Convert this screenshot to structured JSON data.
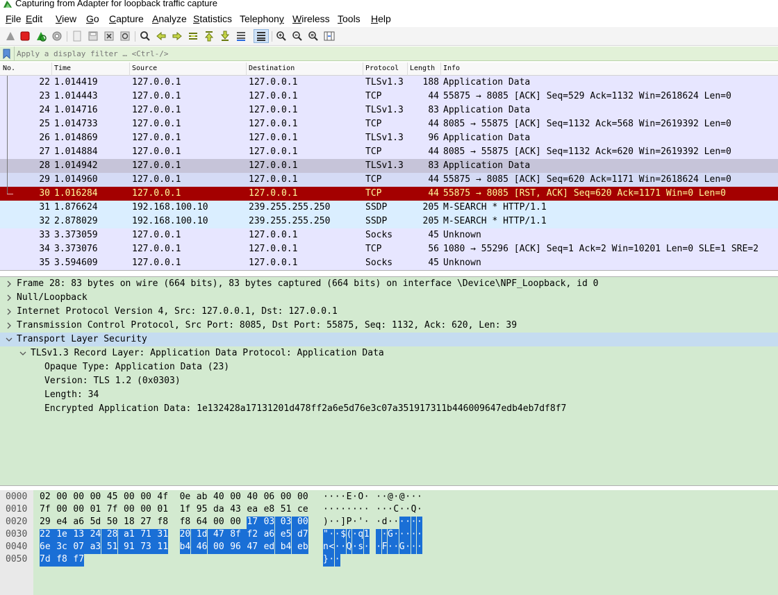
{
  "window": {
    "title": "Capturing from Adapter for loopback traffic capture"
  },
  "menu": [
    {
      "pre": "",
      "u": "F",
      "post": "ile"
    },
    {
      "pre": "",
      "u": "E",
      "post": "dit"
    },
    {
      "pre": "",
      "u": "V",
      "post": "iew"
    },
    {
      "pre": "",
      "u": "G",
      "post": "o"
    },
    {
      "pre": "",
      "u": "C",
      "post": "apture"
    },
    {
      "pre": "",
      "u": "A",
      "post": "nalyze"
    },
    {
      "pre": "",
      "u": "S",
      "post": "tatistics"
    },
    {
      "pre": "Telephon",
      "u": "y",
      "post": ""
    },
    {
      "pre": "",
      "u": "W",
      "post": "ireless"
    },
    {
      "pre": "",
      "u": "T",
      "post": "ools"
    },
    {
      "pre": "",
      "u": "H",
      "post": "elp"
    }
  ],
  "filter": {
    "placeholder": "Apply a display filter … <Ctrl-/>"
  },
  "columns": [
    "No.",
    "Time",
    "Source",
    "Destination",
    "Protocol",
    "Length",
    "Info"
  ],
  "packets": [
    {
      "no": "22",
      "time": "1.014419",
      "src": "127.0.0.1",
      "dst": "127.0.0.1",
      "proto": "TLSv1.3",
      "len": "188",
      "info": "Application Data",
      "style": "tls"
    },
    {
      "no": "23",
      "time": "1.014443",
      "src": "127.0.0.1",
      "dst": "127.0.0.1",
      "proto": "TCP",
      "len": "44",
      "info": "55875 → 8085 [ACK] Seq=529 Ack=1132 Win=2618624 Len=0",
      "style": "tls"
    },
    {
      "no": "24",
      "time": "1.014716",
      "src": "127.0.0.1",
      "dst": "127.0.0.1",
      "proto": "TLSv1.3",
      "len": "83",
      "info": "Application Data",
      "style": "tls"
    },
    {
      "no": "25",
      "time": "1.014733",
      "src": "127.0.0.1",
      "dst": "127.0.0.1",
      "proto": "TCP",
      "len": "44",
      "info": "8085 → 55875 [ACK] Seq=1132 Ack=568 Win=2619392 Len=0",
      "style": "tls"
    },
    {
      "no": "26",
      "time": "1.014869",
      "src": "127.0.0.1",
      "dst": "127.0.0.1",
      "proto": "TLSv1.3",
      "len": "96",
      "info": "Application Data",
      "style": "tls"
    },
    {
      "no": "27",
      "time": "1.014884",
      "src": "127.0.0.1",
      "dst": "127.0.0.1",
      "proto": "TCP",
      "len": "44",
      "info": "8085 → 55875 [ACK] Seq=1132 Ack=620 Win=2619392 Len=0",
      "style": "tls"
    },
    {
      "no": "28",
      "time": "1.014942",
      "src": "127.0.0.1",
      "dst": "127.0.0.1",
      "proto": "TLSv1.3",
      "len": "83",
      "info": "Application Data",
      "style": "selected"
    },
    {
      "no": "29",
      "time": "1.014960",
      "src": "127.0.0.1",
      "dst": "127.0.0.1",
      "proto": "TCP",
      "len": "44",
      "info": "55875 → 8085 [ACK] Seq=620 Ack=1171 Win=2618624 Len=0",
      "style": "related"
    },
    {
      "no": "30",
      "time": "1.016284",
      "src": "127.0.0.1",
      "dst": "127.0.0.1",
      "proto": "TCP",
      "len": "44",
      "info": "55875 → 8085 [RST, ACK] Seq=620 Ack=1171 Win=0 Len=0",
      "style": "rst"
    },
    {
      "no": "31",
      "time": "1.876624",
      "src": "192.168.100.10",
      "dst": "239.255.255.250",
      "proto": "SSDP",
      "len": "205",
      "info": "M-SEARCH * HTTP/1.1",
      "style": "udp"
    },
    {
      "no": "32",
      "time": "2.878029",
      "src": "192.168.100.10",
      "dst": "239.255.255.250",
      "proto": "SSDP",
      "len": "205",
      "info": "M-SEARCH * HTTP/1.1",
      "style": "udp"
    },
    {
      "no": "33",
      "time": "3.373059",
      "src": "127.0.0.1",
      "dst": "127.0.0.1",
      "proto": "Socks",
      "len": "45",
      "info": "Unknown",
      "style": "tls"
    },
    {
      "no": "34",
      "time": "3.373076",
      "src": "127.0.0.1",
      "dst": "127.0.0.1",
      "proto": "TCP",
      "len": "56",
      "info": "1080 → 55296 [ACK] Seq=1 Ack=2 Win=10201 Len=0 SLE=1 SRE=2",
      "style": "tls"
    },
    {
      "no": "35",
      "time": "3.594609",
      "src": "127.0.0.1",
      "dst": "127.0.0.1",
      "proto": "Socks",
      "len": "45",
      "info": "Unknown",
      "style": "tls"
    }
  ],
  "details": [
    {
      "text": "Frame 28: 83 bytes on wire (664 bits), 83 bytes captured (664 bits) on interface \\Device\\NPF_Loopback, id 0",
      "level": 0,
      "arrow": "right",
      "selected": false
    },
    {
      "text": "Null/Loopback",
      "level": 0,
      "arrow": "right",
      "selected": false
    },
    {
      "text": "Internet Protocol Version 4, Src: 127.0.0.1, Dst: 127.0.0.1",
      "level": 0,
      "arrow": "right",
      "selected": false
    },
    {
      "text": "Transmission Control Protocol, Src Port: 8085, Dst Port: 55875, Seq: 1132, Ack: 620, Len: 39",
      "level": 0,
      "arrow": "right",
      "selected": false
    },
    {
      "text": "Transport Layer Security",
      "level": 0,
      "arrow": "down",
      "selected": true
    },
    {
      "text": "TLSv1.3 Record Layer: Application Data Protocol: Application Data",
      "level": 1,
      "arrow": "down",
      "selected": false
    },
    {
      "text": "Opaque Type: Application Data (23)",
      "level": 2,
      "arrow": "none",
      "selected": false
    },
    {
      "text": "Version: TLS 1.2 (0x0303)",
      "level": 2,
      "arrow": "none",
      "selected": false
    },
    {
      "text": "Length: 34",
      "level": 2,
      "arrow": "none",
      "selected": false
    },
    {
      "text": "Encrypted Application Data: 1e132428a17131201d478ff2a6e5d76e3c07a351917311b446009647edb4eb7df8f7",
      "level": 2,
      "arrow": "none",
      "selected": false
    }
  ],
  "bytes": [
    {
      "offset": "0000",
      "hex": [
        "02",
        "00",
        "00",
        "00",
        "45",
        "00",
        "00",
        "4f",
        "0e",
        "ab",
        "40",
        "00",
        "40",
        "06",
        "00",
        "00"
      ],
      "ascii": [
        "·",
        "·",
        "·",
        "·",
        "E",
        "·",
        "O",
        "·",
        "·",
        "·",
        "@",
        "·",
        "@",
        "·",
        "·",
        "·"
      ],
      "hl_from": 16
    },
    {
      "offset": "0010",
      "hex": [
        "7f",
        "00",
        "00",
        "01",
        "7f",
        "00",
        "00",
        "01",
        "1f",
        "95",
        "da",
        "43",
        "ea",
        "e8",
        "51",
        "ce"
      ],
      "ascii": [
        "·",
        "·",
        "·",
        "·",
        "·",
        "·",
        "·",
        "·",
        "·",
        "·",
        "·",
        "C",
        "·",
        "·",
        "Q",
        "·"
      ],
      "hl_from": 16
    },
    {
      "offset": "0020",
      "hex": [
        "29",
        "e4",
        "a6",
        "5d",
        "50",
        "18",
        "27",
        "f8",
        "f8",
        "64",
        "00",
        "00",
        "17",
        "03",
        "03",
        "00"
      ],
      "ascii": [
        ")",
        "·",
        "·",
        "]",
        "P",
        "·",
        "'",
        "·",
        "·",
        "d",
        "·",
        "·",
        "·",
        "·",
        "·",
        "·"
      ],
      "hl_from": 12
    },
    {
      "offset": "0030",
      "hex": [
        "22",
        "1e",
        "13",
        "24",
        "28",
        "a1",
        "71",
        "31",
        "20",
        "1d",
        "47",
        "8f",
        "f2",
        "a6",
        "e5",
        "d7"
      ],
      "ascii": [
        "\"",
        "·",
        "·",
        "$",
        "(",
        "·",
        "q",
        "1",
        " ",
        "·",
        "G",
        "·",
        "·",
        "·",
        "·",
        "·"
      ],
      "hl_from": 0
    },
    {
      "offset": "0040",
      "hex": [
        "6e",
        "3c",
        "07",
        "a3",
        "51",
        "91",
        "73",
        "11",
        "b4",
        "46",
        "00",
        "96",
        "47",
        "ed",
        "b4",
        "eb"
      ],
      "ascii": [
        "n",
        "<",
        "·",
        "·",
        "Q",
        "·",
        "s",
        "·",
        "·",
        "F",
        "·",
        "·",
        "G",
        "·",
        "·",
        "·"
      ],
      "hl_from": 0
    },
    {
      "offset": "0050",
      "hex": [
        "7d",
        "f8",
        "f7"
      ],
      "ascii": [
        "}",
        "·",
        "·"
      ],
      "hl_from": 0
    }
  ],
  "colors": {
    "tls": "#e7e6ff",
    "selected": "#c6c4d9",
    "related": "#d5dbf5",
    "rst": "#a40000",
    "rst_text": "#fffc9c",
    "udp": "#daeeff",
    "detail_bg": "#d3ead0"
  },
  "toolbar_icons": [
    "shark-fin-icon",
    "stop-icon",
    "restart-icon",
    "options-icon",
    "open-icon",
    "save-icon",
    "close-icon",
    "reload-icon",
    "find-icon",
    "back-icon",
    "forward-icon",
    "goto-icon",
    "first-icon",
    "last-icon",
    "autoscroll-icon",
    "colorize-icon",
    "zoom-in-icon",
    "zoom-out-icon",
    "zoom-reset-icon",
    "resize-columns-icon"
  ]
}
